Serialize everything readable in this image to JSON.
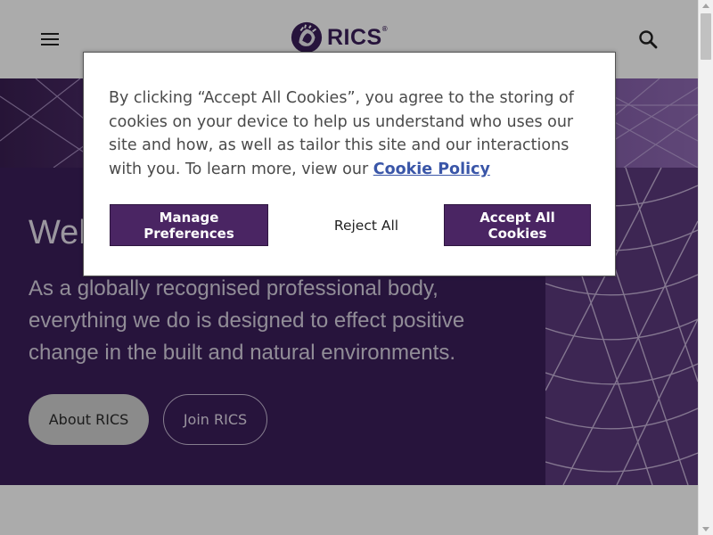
{
  "header": {
    "menu_icon": "hamburger-icon",
    "logo_text": "RICS",
    "logo_registered": "®",
    "search_icon": "search-icon",
    "brand_color": "#3b1e5a"
  },
  "hero": {
    "title": "Welcome to RICS",
    "body": "As a globally recognised professional body, everything we do is designed to effect positive change in the built and natural environments.",
    "buttons": {
      "about": "About RICS",
      "join": "Join RICS"
    }
  },
  "cookie_banner": {
    "text_before_link": "By clicking “Accept All Cookies”, you agree to the storing of cookies on your device to help us understand who uses our site and how, as well as tailor this site and our interactions with you. To learn more, view our ",
    "policy_link": "Cookie Policy",
    "buttons": {
      "manage": "Manage Preferences",
      "reject": "Reject All",
      "accept": "Accept All Cookies"
    },
    "accent_color": "#4a2563"
  }
}
